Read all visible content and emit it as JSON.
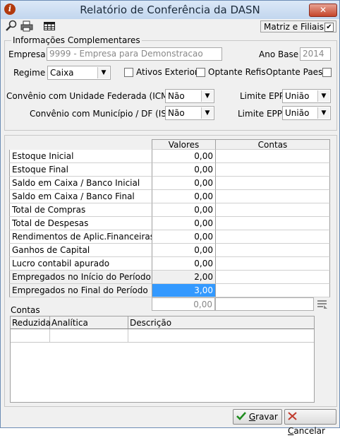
{
  "window": {
    "title": "Relatório de Conferência da DASN",
    "close_label": "✕"
  },
  "toolbar": {
    "matriz_label": "Matriz e Filiais",
    "matriz_checked": true
  },
  "info": {
    "group_title": "Informações Complementares",
    "empresa_label": "Empresa :",
    "empresa_value": "9999 -  Empresa para Demonstracao",
    "ano_base_label": "Ano Base :",
    "ano_base_value": "2014",
    "regime_label": "Regime :",
    "regime_value": "Caixa",
    "ativos_exterior_label": "Ativos Exterior",
    "optante_refis_label": "Optante Refis",
    "optante_paes_label": "Optante Paes",
    "convenio_icms_label": "Convênio com Unidade Federada (ICMS) :",
    "convenio_icms_value": "Não",
    "convenio_iss_label": "Convênio com Município / DF (ISS) :",
    "convenio_iss_value": "Não",
    "limite_epp_label_1": "Limite EPP :",
    "limite_epp_value_1": "União",
    "limite_epp_label_2": "Limite EPP :",
    "limite_epp_value_2": "União"
  },
  "values_grid": {
    "col_valores": "Valores",
    "col_contas": "Contas",
    "rows": [
      {
        "label": "Estoque Inicial",
        "value": "0,00"
      },
      {
        "label": "Estoque Final",
        "value": "0,00"
      },
      {
        "label": "Saldo em Caixa / Banco Inicial",
        "value": "0,00"
      },
      {
        "label": "Saldo em Caixa / Banco Final",
        "value": "0,00"
      },
      {
        "label": "Total de Compras",
        "value": "0,00"
      },
      {
        "label": "Total de Despesas",
        "value": "0,00"
      },
      {
        "label": "Rendimentos de Aplic.Financeiras",
        "value": "0,00"
      },
      {
        "label": "Ganhos de Capital",
        "value": "0,00"
      },
      {
        "label": "Lucro contabil apurado",
        "value": "0,00"
      },
      {
        "label": "Empregados no Início do Período",
        "value": "2,00"
      },
      {
        "label": "Empregados no Final do Período",
        "value": "3,00"
      }
    ],
    "total": "0,00"
  },
  "contas": {
    "label": "Contas",
    "columns": [
      "Reduzida",
      "Analítica",
      "Descrição"
    ]
  },
  "buttons": {
    "gravar_first": "G",
    "gravar_rest": "ravar",
    "cancelar_first": "C",
    "cancelar_rest": "ancelar"
  },
  "colors": {
    "selection": "#3399ff",
    "ok_green": "#1e8c1e",
    "cancel_red": "#c0392b"
  }
}
